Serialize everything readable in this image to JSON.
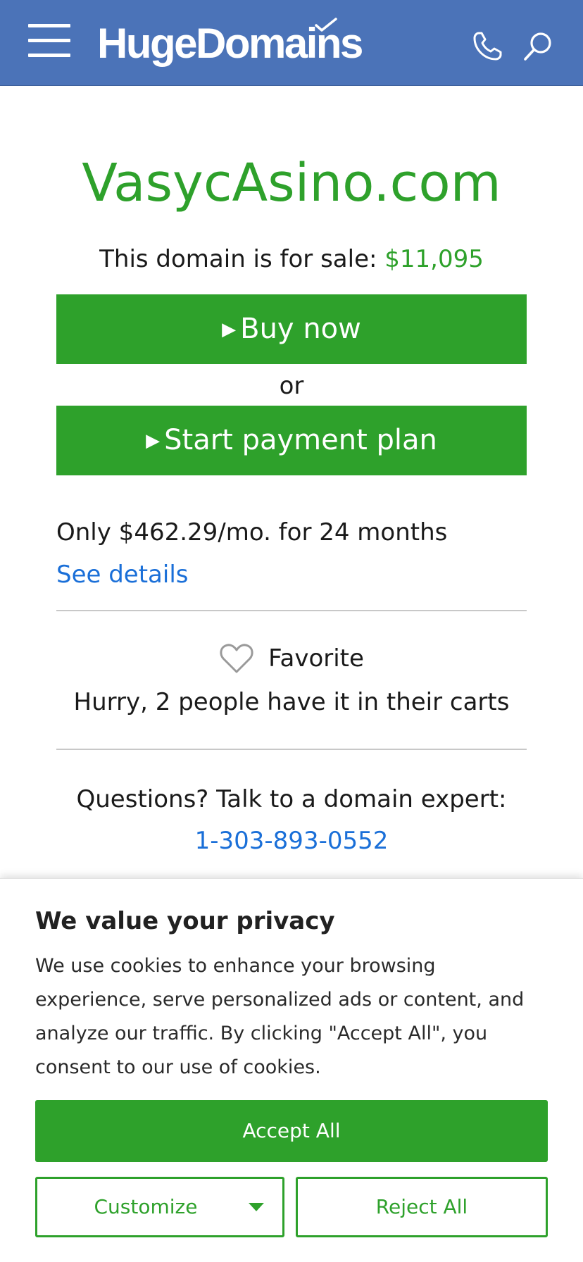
{
  "header": {
    "logo_text": "HugeDomains",
    "menu_icon": "hamburger-menu-icon",
    "phone_icon": "phone-icon",
    "search_icon": "search-icon",
    "bg_color": "#4b73b8"
  },
  "main": {
    "domain_name": "VasycAsino.com",
    "sale_text": "This domain is for sale:",
    "price": "$11,095",
    "buy_now_label": "Buy now",
    "or_text": "or",
    "payment_plan_label": "Start payment plan",
    "plan_text": "Only $462.29/mo. for 24 months",
    "see_details": "See details",
    "favorite_label": "Favorite",
    "hurry_text": "Hurry, 2 people have it in their carts",
    "questions_text": "Questions? Talk to a domain expert:",
    "phone_number": "1-303-893-0552",
    "accent_color": "#2ea12b",
    "link_color": "#1a6fd8"
  },
  "cookie_banner": {
    "title": "We value your privacy",
    "body": "We use cookies to enhance your browsing experience, serve personalized ads or content, and analyze our traffic. By clicking \"Accept All\", you consent to our use of cookies.",
    "accept_label": "Accept All",
    "customize_label": "Customize",
    "reject_label": "Reject All"
  }
}
